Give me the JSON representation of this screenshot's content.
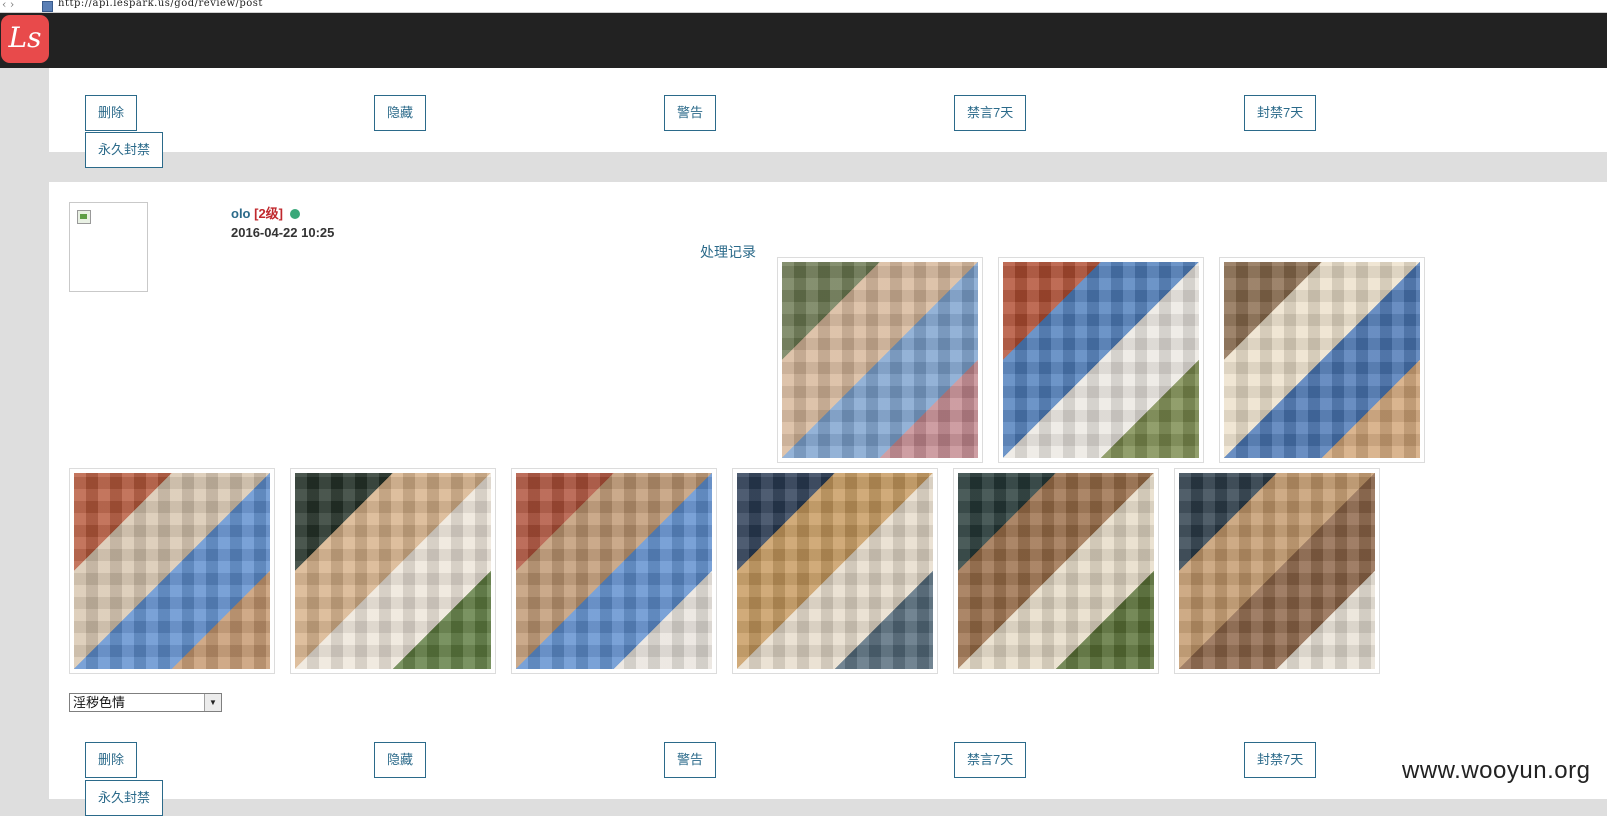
{
  "browser": {
    "url": "http://api.lespark.us/god/review/post"
  },
  "header": {
    "logo_text": "Ls",
    "brand_color": "#e84a4b"
  },
  "actions_top": [
    "删除",
    "隐藏",
    "警告",
    "禁言7天",
    "封禁7天",
    "永久封禁"
  ],
  "post": {
    "username": "olo",
    "level": "[2级]",
    "timestamp": "2016-04-22 10:25",
    "record_link": "处理记录",
    "images_row1": [
      {
        "palette": [
          "#6c7a52",
          "#d7b79a",
          "#7ea3cf",
          "#c58a90"
        ]
      },
      {
        "palette": [
          "#b24e33",
          "#4f7fbd",
          "#ece8e2",
          "#7c8b4e"
        ]
      },
      {
        "palette": [
          "#8a6b4d",
          "#ede1cb",
          "#4b77b5",
          "#d3a678"
        ]
      }
    ],
    "images_row2": [
      {
        "palette": [
          "#b85a3d",
          "#d8c7b0",
          "#5f8fcf",
          "#c79870"
        ]
      },
      {
        "palette": [
          "#26342a",
          "#d7b28a",
          "#eee6da",
          "#5f7d41"
        ]
      },
      {
        "palette": [
          "#b0513a",
          "#c09873",
          "#5f8fcf",
          "#e9e4dd"
        ]
      },
      {
        "palette": [
          "#2a3c55",
          "#c89a5e",
          "#e7dccb",
          "#556b7c"
        ]
      },
      {
        "palette": [
          "#263a38",
          "#9b6e49",
          "#e7dcc8",
          "#5a7236"
        ]
      },
      {
        "palette": [
          "#2d3e4b",
          "#c59a6d",
          "#8d6548",
          "#e9e2d6"
        ]
      }
    ]
  },
  "violation_select": {
    "selected": "淫秽色情"
  },
  "actions_bottom": [
    "删除",
    "隐藏",
    "警告",
    "禁言7天",
    "封禁7天",
    "永久封禁"
  ],
  "watermark": "www.wooyun.org"
}
